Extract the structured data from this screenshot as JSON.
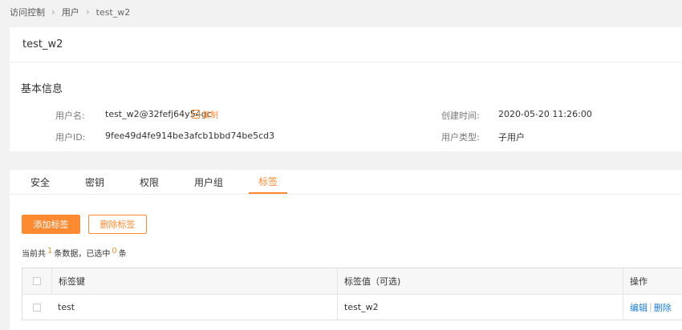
{
  "breadcrumb": {
    "items": [
      "访问控制",
      "用户",
      "test_w2"
    ]
  },
  "user": {
    "title": "test_w2",
    "section_title": "基本信息",
    "username_label": "用户名:",
    "username_value": "test_w2@32fefj64y54gc",
    "copy_label": "复制",
    "userid_label": "用户ID:",
    "userid_value": "9fee49d4fe914be3afcb1bbd74be5cd3",
    "created_label": "创建时间:",
    "created_value": "2020-05-20 11:26:00",
    "type_label": "用户类型:",
    "type_value": "子用户"
  },
  "tabs": [
    {
      "label": "安全",
      "active": false
    },
    {
      "label": "密钥",
      "active": false
    },
    {
      "label": "权限",
      "active": false
    },
    {
      "label": "用户组",
      "active": false
    },
    {
      "label": "标签",
      "active": true
    }
  ],
  "actions": {
    "add_label": "添加标签",
    "delete_label": "删除标签"
  },
  "summary": {
    "prefix": "当前共",
    "total": "1",
    "middle": "条数据，已选中",
    "selected": "0",
    "suffix": "条"
  },
  "table": {
    "headers": [
      "标签键",
      "标签值（可选)",
      "操作"
    ],
    "rows": [
      {
        "key": "test",
        "value": "test_w2",
        "edit": "编辑",
        "delete": "删除"
      }
    ]
  },
  "colors": {
    "accent": "#ff8a30",
    "link": "#1e7fd6"
  }
}
